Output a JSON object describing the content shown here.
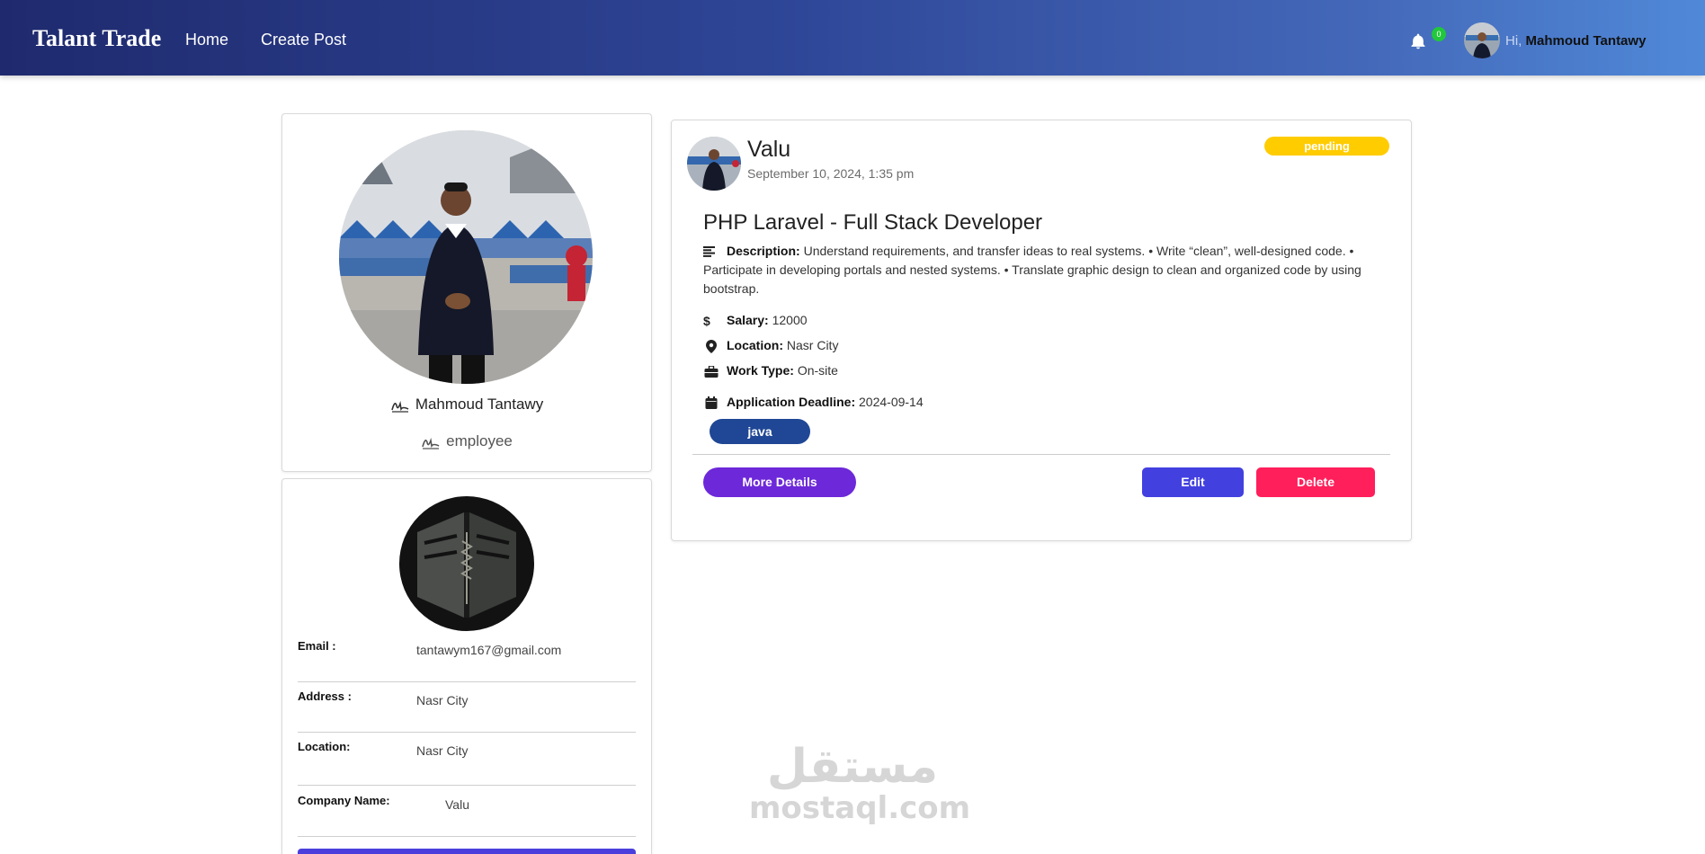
{
  "navbar": {
    "brand": "Talant Trade",
    "links": [
      {
        "label": "Home"
      },
      {
        "label": "Create Post"
      }
    ],
    "notification_count": "0",
    "greeting_prefix": "Hi,",
    "user_name": "Mahmoud Tantawy"
  },
  "profile": {
    "name": "Mahmoud Tantawy",
    "role": "employee"
  },
  "info": {
    "rows": [
      {
        "label": "Email :",
        "value": "tantawym167@gmail.com"
      },
      {
        "label": "Address :",
        "value": "Nasr City"
      },
      {
        "label": "Location:",
        "value": "Nasr City"
      },
      {
        "label": "Company Name:",
        "value": "Valu"
      }
    ]
  },
  "post": {
    "company": "Valu",
    "date": "September 10, 2024, 1:35 pm",
    "status": "pending",
    "title": "PHP Laravel - Full Stack Developer",
    "description_label": "Description:",
    "description": "Understand requirements, and transfer ideas to real systems. • Write “clean”, well-designed code. • Participate in developing portals and nested systems. • Translate graphic design to clean and organized code by using bootstrap.",
    "salary_label": "Salary:",
    "salary": "12000",
    "location_label": "Location:",
    "location": "Nasr City",
    "work_type_label": "Work Type:",
    "work_type": "On-site",
    "deadline_label": "Application Deadline:",
    "deadline": "2024-09-14",
    "skills": [
      "java"
    ],
    "buttons": {
      "more": "More Details",
      "edit": "Edit",
      "delete": "Delete"
    }
  },
  "watermark": {
    "arabic": "مستقل",
    "latin": "mostaql.com"
  },
  "colors": {
    "nav_start": "#1f2a6e",
    "nav_end": "#5089d8",
    "status_pending": "#ffcc00",
    "skill": "#1f4795",
    "more_button": "#6d28d9",
    "edit_button": "#4340e0",
    "delete_button": "#ff1f5b",
    "badge": "#21c83b"
  }
}
